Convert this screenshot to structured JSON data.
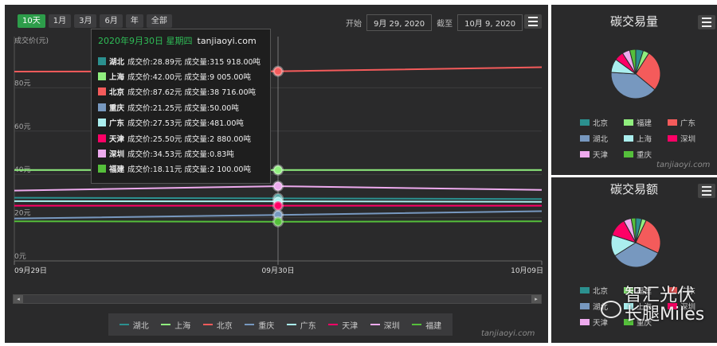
{
  "toolbar": {
    "ranges": [
      "10天",
      "1月",
      "3月",
      "6月",
      "年",
      "全部"
    ],
    "start_label": "开始",
    "start_value": "9月 29, 2020",
    "end_label": "截至",
    "end_value": "10月 9, 2020"
  },
  "chart_data": [
    {
      "type": "line",
      "ylabel": "成交价(元)",
      "ylim": [
        0,
        100
      ],
      "yticks": [
        "0元",
        "20元",
        "40元",
        "60元",
        "80元"
      ],
      "x": [
        "09月29日",
        "09月30日",
        "10月09日"
      ],
      "grid": true,
      "legend_position": "bottom",
      "series": [
        {
          "name": "湖北",
          "color": "#2b908f",
          "values": [
            29.2,
            28.89,
            28.6
          ]
        },
        {
          "name": "上海",
          "color": "#90ee7e",
          "values": [
            42.0,
            42.0,
            42.0
          ]
        },
        {
          "name": "北京",
          "color": "#f45b5b",
          "values": [
            87.5,
            87.62,
            89.5
          ]
        },
        {
          "name": "重庆",
          "color": "#7798bf",
          "values": [
            19.6,
            21.25,
            23.0
          ]
        },
        {
          "name": "广东",
          "color": "#aaeeee",
          "values": [
            27.6,
            27.53,
            27.3
          ]
        },
        {
          "name": "天津",
          "color": "#ff0066",
          "values": [
            25.5,
            25.5,
            25.5
          ]
        },
        {
          "name": "深圳",
          "color": "#eeaaee",
          "values": [
            32.5,
            34.53,
            32.8
          ]
        },
        {
          "name": "福建",
          "color": "#55bf3b",
          "values": [
            18.3,
            18.11,
            18.3
          ]
        }
      ],
      "tooltip": {
        "title": "2020年9月30日 星期四",
        "site": "tanjiaoyi.com",
        "rows": [
          {
            "name": "湖北",
            "color": "#2b908f",
            "text": "成交价:28.89元 成交量:315 918.00吨"
          },
          {
            "name": "上海",
            "color": "#90ee7e",
            "text": "成交价:42.00元 成交量:9 005.00吨"
          },
          {
            "name": "北京",
            "color": "#f45b5b",
            "text": "成交价:87.62元 成交量:38 716.00吨"
          },
          {
            "name": "重庆",
            "color": "#7798bf",
            "text": "成交价:21.25元 成交量:50.00吨"
          },
          {
            "name": "广东",
            "color": "#aaeeee",
            "text": "成交价:27.53元 成交量:481.00吨"
          },
          {
            "name": "天津",
            "color": "#ff0066",
            "text": "成交价:25.50元 成交量:2 880.00吨"
          },
          {
            "name": "深圳",
            "color": "#eeaaee",
            "text": "成交价:34.53元 成交量:0.83吨"
          },
          {
            "name": "福建",
            "color": "#55bf3b",
            "text": "成交价:18.11元 成交量:2 100.00吨"
          }
        ]
      }
    },
    {
      "type": "pie",
      "title": "碳交易量",
      "slices": [
        {
          "name": "北京",
          "color": "#2b908f",
          "value": 5
        },
        {
          "name": "福建",
          "color": "#90ee7e",
          "value": 4
        },
        {
          "name": "广东",
          "color": "#f45b5b",
          "value": 27
        },
        {
          "name": "湖北",
          "color": "#7798bf",
          "value": 40
        },
        {
          "name": "上海",
          "color": "#aaeeee",
          "value": 9
        },
        {
          "name": "深圳",
          "color": "#ff0066",
          "value": 6
        },
        {
          "name": "天津",
          "color": "#eeaaee",
          "value": 5
        },
        {
          "name": "重庆",
          "color": "#55bf3b",
          "value": 4
        }
      ]
    },
    {
      "type": "pie",
      "title": "碳交易额",
      "slices": [
        {
          "name": "北京",
          "color": "#2b908f",
          "value": 4
        },
        {
          "name": "福建",
          "color": "#90ee7e",
          "value": 3
        },
        {
          "name": "广东",
          "color": "#f45b5b",
          "value": 25
        },
        {
          "name": "湖北",
          "color": "#7798bf",
          "value": 34
        },
        {
          "name": "上海",
          "color": "#aaeeee",
          "value": 14
        },
        {
          "name": "深圳",
          "color": "#ff0066",
          "value": 12
        },
        {
          "name": "天津",
          "color": "#eeaaee",
          "value": 5
        },
        {
          "name": "重庆",
          "color": "#55bf3b",
          "value": 3
        }
      ]
    }
  ],
  "pie_legend_order": [
    "北京",
    "福建",
    "广东",
    "湖北",
    "上海",
    "深圳",
    "天津",
    "重庆"
  ],
  "watermark": "tanjiaoyi.com",
  "overlay": {
    "line1": "智汇光伏",
    "line2": "长腿Miles"
  }
}
